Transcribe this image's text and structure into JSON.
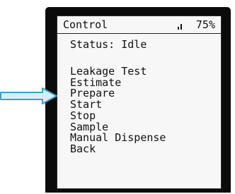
{
  "screen": {
    "title": "Control",
    "battery": "75%",
    "status": "Status: Idle"
  },
  "menu": {
    "items": [
      {
        "label": "Leakage Test"
      },
      {
        "label": "Estimate"
      },
      {
        "label": "Prepare"
      },
      {
        "label": "Start"
      },
      {
        "label": "Stop"
      },
      {
        "label": "Sample"
      },
      {
        "label": "Manual Dispense"
      },
      {
        "label": "Back"
      }
    ],
    "pointed_index": 2
  },
  "colors": {
    "bezel": "#0b0b0b",
    "lcd_background": "#f7f7f7",
    "lcd_text": "#111111",
    "arrow_fill": "#d7eef8",
    "arrow_stroke": "#3a9fd0"
  },
  "icons": {
    "signal": "signal-strength-icon",
    "pointer": "arrow-right-icon"
  }
}
